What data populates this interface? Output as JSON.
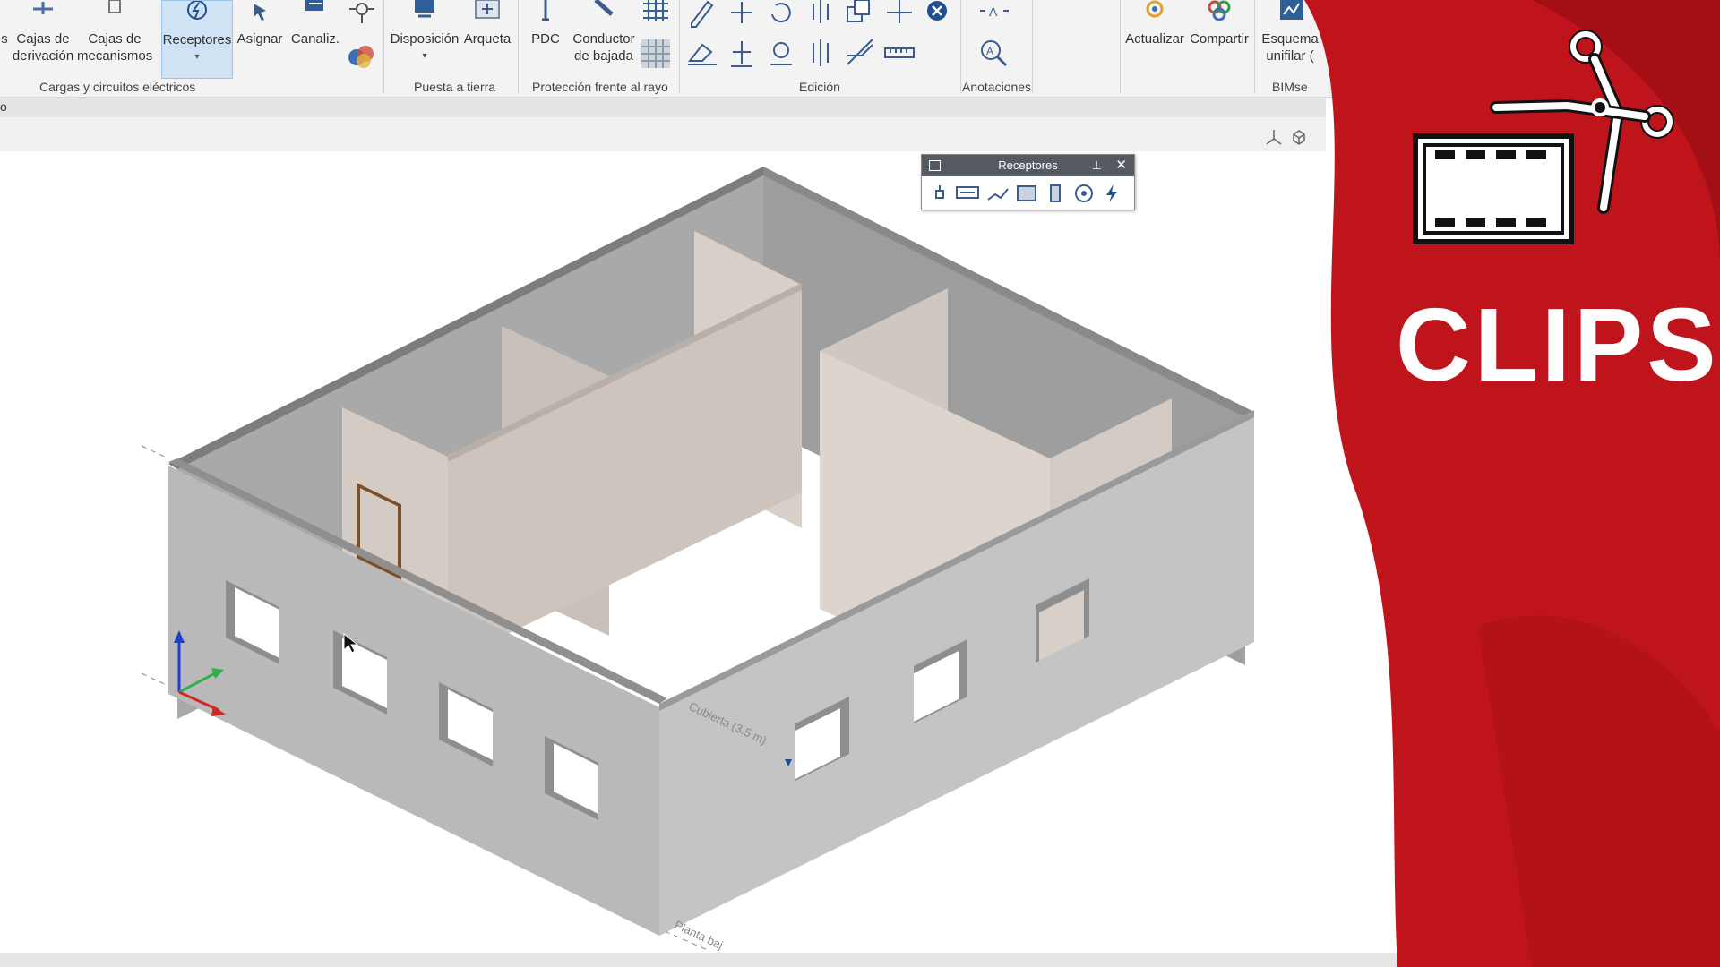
{
  "ribbon": {
    "buttons": {
      "cajas_derivacion": "Cajas de\nderivación",
      "cajas_mecanismos": "Cajas de\nmecanismos",
      "receptores": "Receptores",
      "asignar": "Asignar",
      "canaliz": "Canaliz.",
      "disposicion": "Disposición",
      "arqueta": "Arqueta",
      "pdc": "PDC",
      "conductor_bajada": "Conductor\nde bajada",
      "actualizar": "Actualizar",
      "compartir": "Compartir",
      "esquema_unifilar": "Esquema\nunifilar (",
      "partial_left": "s"
    },
    "groups": {
      "cargas": "Cargas y circuitos eléctricos",
      "puesta_tierra": "Puesta a tierra",
      "proteccion_rayo": "Protección frente al rayo",
      "edicion": "Edición",
      "anotaciones": "Anotaciones",
      "bimserver": "BIMse"
    }
  },
  "strip_left_text": "o",
  "floating_panel": {
    "title": "Receptores"
  },
  "viewport_labels": {
    "cubierta": "Cubierta (3.5 m)",
    "planta_baja": "Planta baj"
  },
  "brand": {
    "text": "CLIPS",
    "color": "#c0141c"
  },
  "colors": {
    "accent": "#1f6fc6",
    "wall_outer": "#b6b6b6",
    "wall_inner": "#d8d0c8"
  }
}
